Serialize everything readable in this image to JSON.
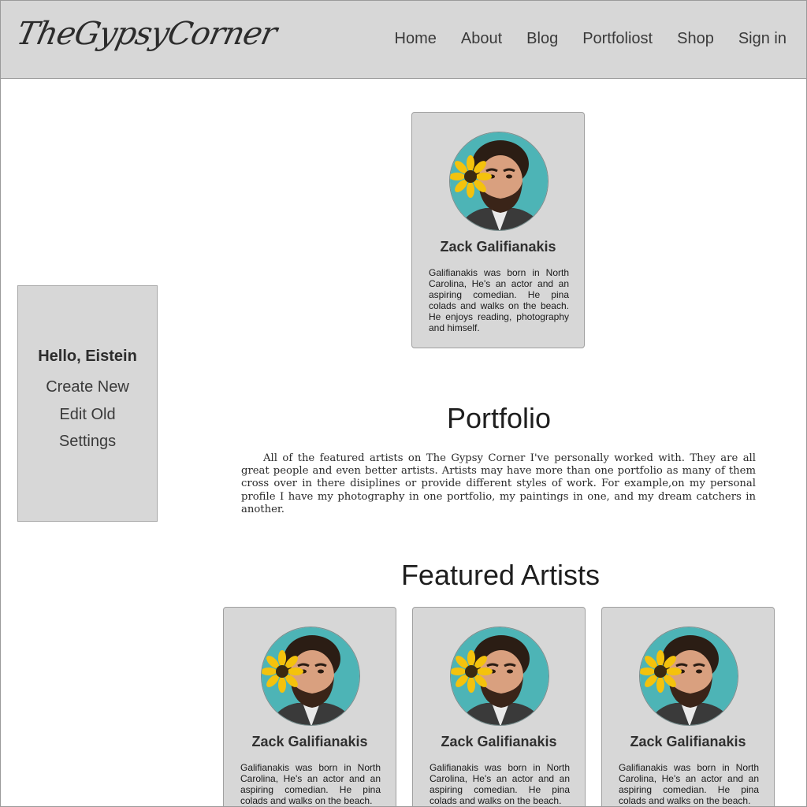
{
  "header": {
    "logo": "TheGypsyCorner",
    "nav": [
      "Home",
      "About",
      "Blog",
      "Portfoliost",
      "Shop",
      "Sign in"
    ]
  },
  "sidebar": {
    "greeting": "Hello, Eistein",
    "links": [
      "Create New",
      "Edit Old",
      "Settings"
    ]
  },
  "profile_card": {
    "name": "Zack Galifianakis",
    "bio": "Galifianakis was born in North Carolina, He's an actor and an aspiring comedian. He pina colads and walks on the beach. He enjoys reading, photography and himself.",
    "avatar_icon": "sunflower-portrait"
  },
  "portfolio": {
    "title": "Portfolio",
    "intro": "All of the featured artists on The Gypsy Corner I've personally worked with. They are all great people and even better artists. Artists may have more than one portfolio as many of them cross over in there disiplines or provide different styles of work. For example,on my personal profile I have my photography in one portfolio, my paintings in one, and my dream catchers in another."
  },
  "featured": {
    "title": "Featured Artists",
    "artists": [
      {
        "name": "Zack Galifianakis",
        "bio": "Galifianakis was born in North Carolina, He's an actor and an aspiring comedian. He pina colads and walks on the beach."
      },
      {
        "name": "Zack Galifianakis",
        "bio": "Galifianakis was born in North Carolina, He's an actor and an aspiring comedian. He pina colads and walks on the beach."
      },
      {
        "name": "Zack Galifianakis",
        "bio": "Galifianakis was born in North Carolina, He's an actor and an aspiring comedian. He pina colads and walks on the beach."
      }
    ]
  },
  "colors": {
    "header_bg": "#d7d7d7",
    "card_bg": "#d7d7d7",
    "avatar_bg": "#4bb3b5"
  }
}
